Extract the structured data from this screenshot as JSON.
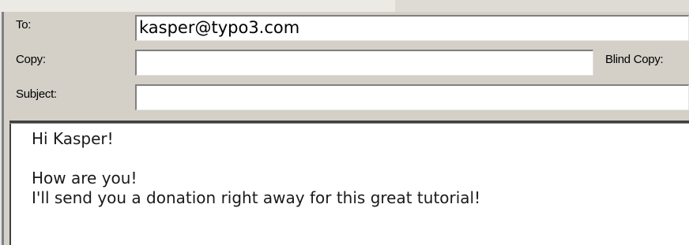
{
  "compose": {
    "to_label": "To:",
    "to_value": "kasper@typo3.com",
    "copy_label": "Copy:",
    "copy_value": "",
    "blind_copy_label": "Blind Copy:",
    "subject_label": "Subject:",
    "subject_value": ""
  },
  "message": {
    "lines": [
      "Hi Kasper!",
      "",
      "How are you!",
      "I'll send you a donation right away for this great tutorial!"
    ]
  },
  "colors": {
    "window_background": "#d4d0c8",
    "input_background": "#ffffff"
  }
}
